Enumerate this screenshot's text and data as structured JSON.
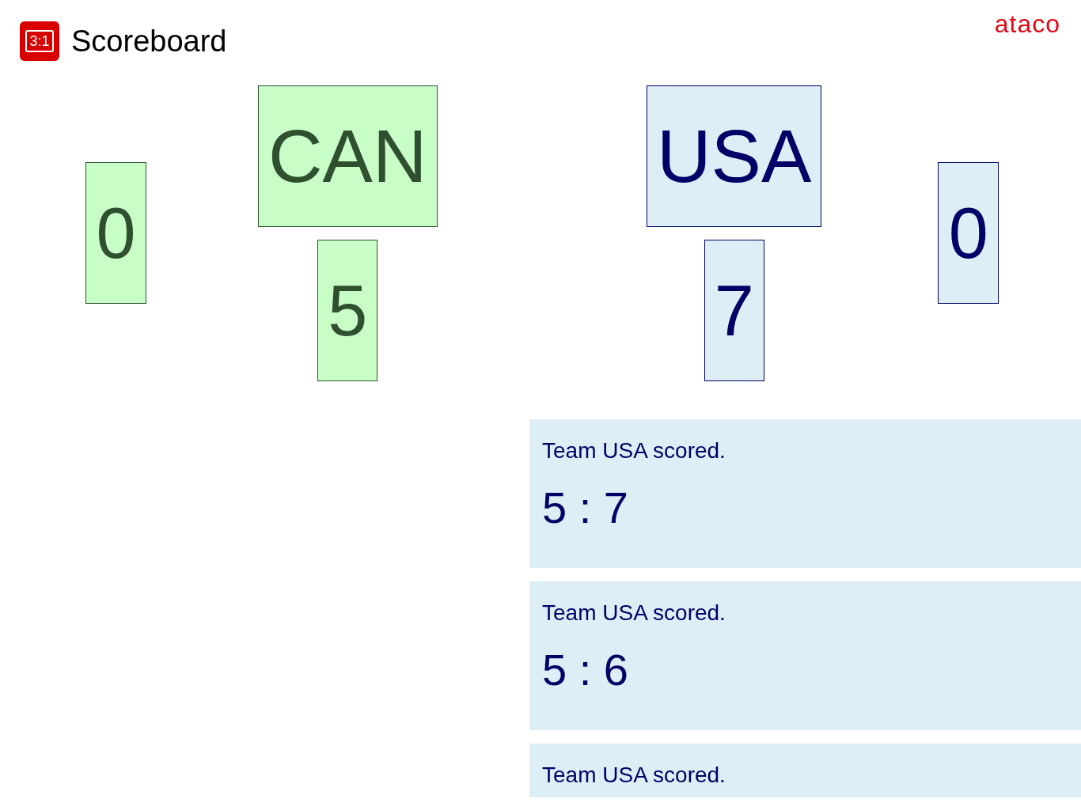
{
  "header": {
    "logo_text": "3:1",
    "title": "Scoreboard",
    "brand": "ataco"
  },
  "teams": [
    {
      "name": "CAN",
      "score": "5",
      "period_score": "0",
      "color": "#2f4f2f"
    },
    {
      "name": "USA",
      "score": "7",
      "period_score": "0",
      "color": "#000066"
    }
  ],
  "events": [
    {
      "message": "Team USA scored.",
      "score": "5 : 7"
    },
    {
      "message": "Team USA scored.",
      "score": "5 : 6"
    },
    {
      "message": "Team USA scored."
    }
  ]
}
